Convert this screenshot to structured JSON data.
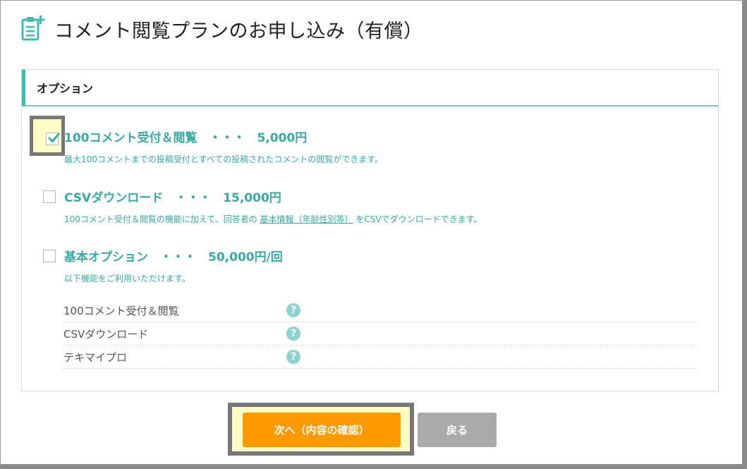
{
  "page": {
    "title": "コメント閲覧プランのお申し込み（有償）",
    "icon": "clipboard-add-icon"
  },
  "panel": {
    "header": "オプション",
    "options": [
      {
        "title": "100コメント受付＆閲覧　・・・　5,000円",
        "description": "最大100コメントまでの投稿受付とすべての投稿されたコメントの閲覧ができます。",
        "checked": true
      },
      {
        "title": "CSVダウンロード　・・・　15,000円",
        "description_before": "100コメント受付＆閲覧の機能に加えて、回答者の",
        "description_link": "基本情報（年齢性別等）",
        "description_after": "をCSVでダウンロードできます。",
        "checked": false
      },
      {
        "title": "基本オプション　・・・　50,000円/回",
        "description": "以下機能をご利用いただけます。",
        "checked": false,
        "features": [
          {
            "label": "100コメント受付＆閲覧",
            "help": "?"
          },
          {
            "label": "CSVダウンロード",
            "help": "?"
          },
          {
            "label": "テキマイプロ",
            "help": "?"
          }
        ]
      }
    ]
  },
  "buttons": {
    "next": "次へ（内容の確認）",
    "back": "戻る"
  },
  "colors": {
    "accent": "#3aa9a3",
    "next_button": "#ff9900",
    "back_button": "#aaaaaa",
    "highlight": "#fffdc7"
  }
}
